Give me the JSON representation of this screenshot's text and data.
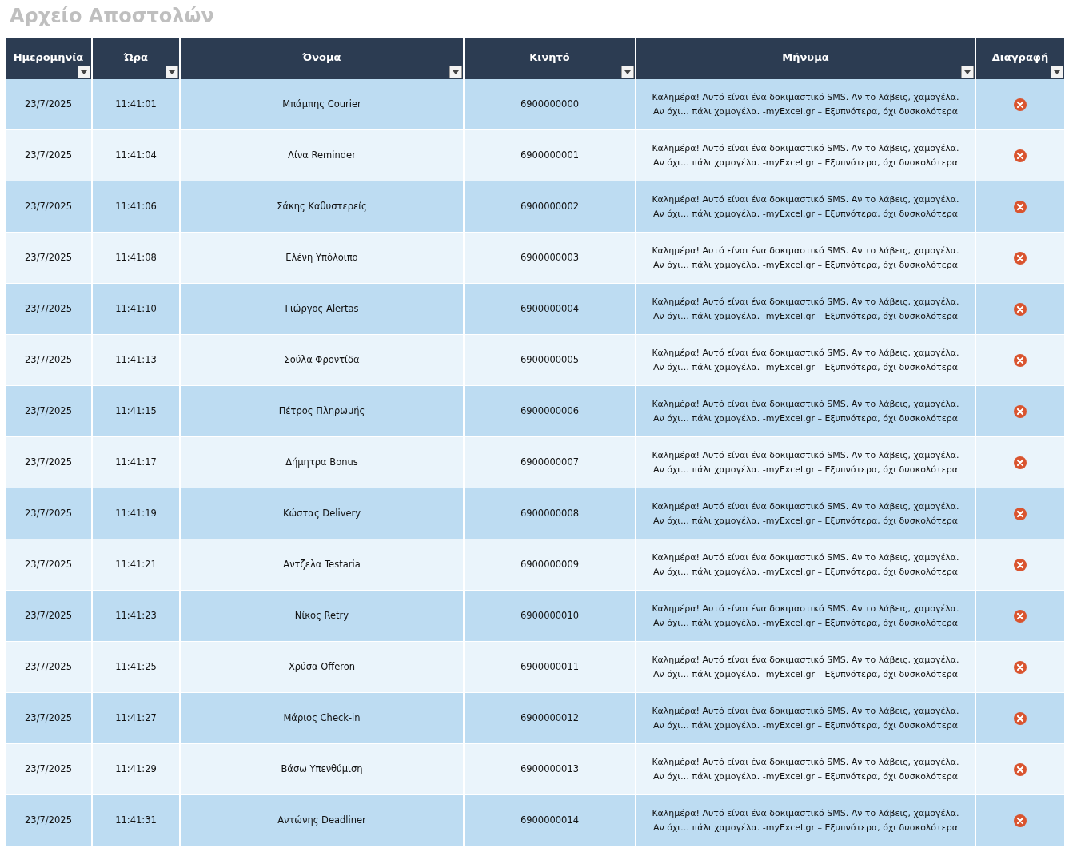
{
  "title": "Αρχείο Αποστολών",
  "table": {
    "columns": [
      "Ημερομηνία",
      "Ώρα",
      "Όνομα",
      "Κινητό",
      "Μήνυμα",
      "Διαγραφή"
    ],
    "rows": [
      {
        "date": "23/7/2025",
        "time": "11:41:01",
        "name": "Μπάμπης Courier",
        "mobile": "6900000000",
        "message": "Καλημέρα! Αυτό είναι ένα δοκιμαστικό SMS. Αν το λάβεις, χαμογέλα. Αν όχι… πάλι χαμογέλα. -myExcel.gr – Εξυπνότερα, όχι δυσκολότερα"
      },
      {
        "date": "23/7/2025",
        "time": "11:41:04",
        "name": "Λίνα Reminder",
        "mobile": "6900000001",
        "message": "Καλημέρα! Αυτό είναι ένα δοκιμαστικό SMS. Αν το λάβεις, χαμογέλα. Αν όχι… πάλι χαμογέλα. -myExcel.gr – Εξυπνότερα, όχι δυσκολότερα"
      },
      {
        "date": "23/7/2025",
        "time": "11:41:06",
        "name": "Σάκης Καθυστερείς",
        "mobile": "6900000002",
        "message": "Καλημέρα! Αυτό είναι ένα δοκιμαστικό SMS. Αν το λάβεις, χαμογέλα. Αν όχι… πάλι χαμογέλα. -myExcel.gr – Εξυπνότερα, όχι δυσκολότερα"
      },
      {
        "date": "23/7/2025",
        "time": "11:41:08",
        "name": "Ελένη Υπόλοιπο",
        "mobile": "6900000003",
        "message": "Καλημέρα! Αυτό είναι ένα δοκιμαστικό SMS. Αν το λάβεις, χαμογέλα. Αν όχι… πάλι χαμογέλα. -myExcel.gr – Εξυπνότερα, όχι δυσκολότερα"
      },
      {
        "date": "23/7/2025",
        "time": "11:41:10",
        "name": "Γιώργος Alertas",
        "mobile": "6900000004",
        "message": "Καλημέρα! Αυτό είναι ένα δοκιμαστικό SMS. Αν το λάβεις, χαμογέλα. Αν όχι… πάλι χαμογέλα. -myExcel.gr – Εξυπνότερα, όχι δυσκολότερα"
      },
      {
        "date": "23/7/2025",
        "time": "11:41:13",
        "name": "Σούλα Φροντίδα",
        "mobile": "6900000005",
        "message": "Καλημέρα! Αυτό είναι ένα δοκιμαστικό SMS. Αν το λάβεις, χαμογέλα. Αν όχι… πάλι χαμογέλα. -myExcel.gr – Εξυπνότερα, όχι δυσκολότερα"
      },
      {
        "date": "23/7/2025",
        "time": "11:41:15",
        "name": "Πέτρος Πληρωμής",
        "mobile": "6900000006",
        "message": "Καλημέρα! Αυτό είναι ένα δοκιμαστικό SMS. Αν το λάβεις, χαμογέλα. Αν όχι… πάλι χαμογέλα. -myExcel.gr – Εξυπνότερα, όχι δυσκολότερα"
      },
      {
        "date": "23/7/2025",
        "time": "11:41:17",
        "name": "Δήμητρα Bonus",
        "mobile": "6900000007",
        "message": "Καλημέρα! Αυτό είναι ένα δοκιμαστικό SMS. Αν το λάβεις, χαμογέλα. Αν όχι… πάλι χαμογέλα. -myExcel.gr – Εξυπνότερα, όχι δυσκολότερα"
      },
      {
        "date": "23/7/2025",
        "time": "11:41:19",
        "name": "Κώστας Delivery",
        "mobile": "6900000008",
        "message": "Καλημέρα! Αυτό είναι ένα δοκιμαστικό SMS. Αν το λάβεις, χαμογέλα. Αν όχι… πάλι χαμογέλα. -myExcel.gr – Εξυπνότερα, όχι δυσκολότερα"
      },
      {
        "date": "23/7/2025",
        "time": "11:41:21",
        "name": "Αντζελα Testaria",
        "mobile": "6900000009",
        "message": "Καλημέρα! Αυτό είναι ένα δοκιμαστικό SMS. Αν το λάβεις, χαμογέλα. Αν όχι… πάλι χαμογέλα. -myExcel.gr – Εξυπνότερα, όχι δυσκολότερα"
      },
      {
        "date": "23/7/2025",
        "time": "11:41:23",
        "name": "Νίκος Retry",
        "mobile": "6900000010",
        "message": "Καλημέρα! Αυτό είναι ένα δοκιμαστικό SMS. Αν το λάβεις, χαμογέλα. Αν όχι… πάλι χαμογέλα. -myExcel.gr – Εξυπνότερα, όχι δυσκολότερα"
      },
      {
        "date": "23/7/2025",
        "time": "11:41:25",
        "name": "Χρύσα Offeron",
        "mobile": "6900000011",
        "message": "Καλημέρα! Αυτό είναι ένα δοκιμαστικό SMS. Αν το λάβεις, χαμογέλα. Αν όχι… πάλι χαμογέλα. -myExcel.gr – Εξυπνότερα, όχι δυσκολότερα"
      },
      {
        "date": "23/7/2025",
        "time": "11:41:27",
        "name": "Μάριος Check-in",
        "mobile": "6900000012",
        "message": "Καλημέρα! Αυτό είναι ένα δοκιμαστικό SMS. Αν το λάβεις, χαμογέλα. Αν όχι… πάλι χαμογέλα. -myExcel.gr – Εξυπνότερα, όχι δυσκολότερα"
      },
      {
        "date": "23/7/2025",
        "time": "11:41:29",
        "name": "Βάσω Υπενθύμιση",
        "mobile": "6900000013",
        "message": "Καλημέρα! Αυτό είναι ένα δοκιμαστικό SMS. Αν το λάβεις, χαμογέλα. Αν όχι… πάλι χαμογέλα. -myExcel.gr – Εξυπνότερα, όχι δυσκολότερα"
      },
      {
        "date": "23/7/2025",
        "time": "11:41:31",
        "name": "Αντώνης Deadliner",
        "mobile": "6900000014",
        "message": "Καλημέρα! Αυτό είναι ένα δοκιμαστικό SMS. Αν το λάβεις, χαμογέλα. Αν όχι… πάλι χαμογέλα. -myExcel.gr – Εξυπνότερα, όχι δυσκολότερα"
      }
    ]
  }
}
